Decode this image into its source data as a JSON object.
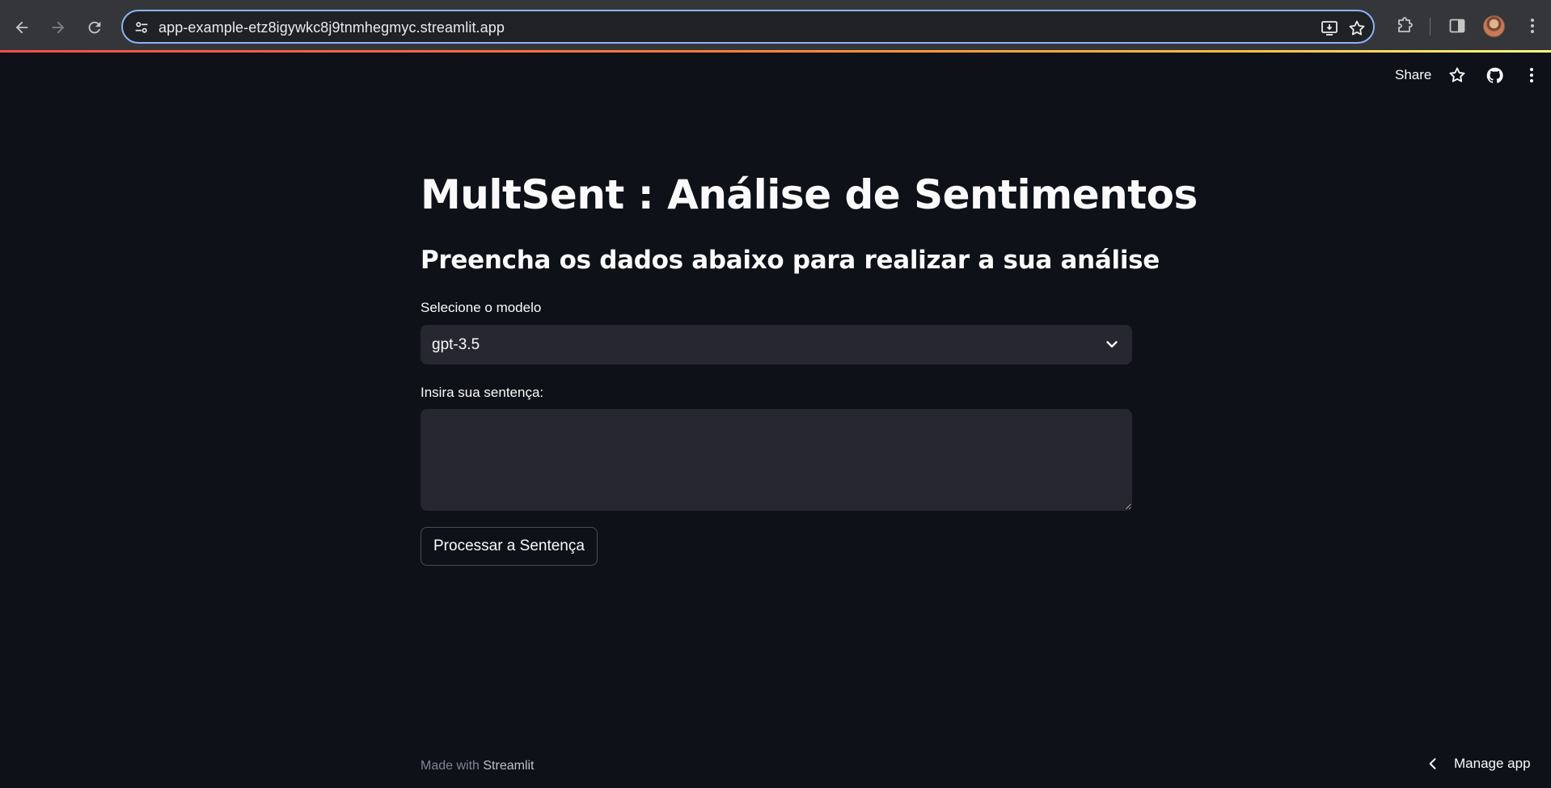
{
  "browser": {
    "url": "app-example-etz8igywkc8j9tnmhegmyc.streamlit.app"
  },
  "header": {
    "share_label": "Share"
  },
  "main": {
    "title": "MultSent : Análise de Sentimentos",
    "subtitle": "Preencha os dados abaixo para realizar a sua análise",
    "model_select": {
      "label": "Selecione o modelo",
      "value": "gpt-3.5"
    },
    "sentence_input": {
      "label": "Insira sua sentença:",
      "value": ""
    },
    "process_button_label": "Processar a Sentença"
  },
  "footer": {
    "made_with": "Made with",
    "brand": "Streamlit",
    "manage_app_label": "Manage app"
  },
  "colors": {
    "background": "#0e1117",
    "widget_background": "#262730",
    "text": "#fafafa",
    "omnibox_focus": "#8ab4f8"
  }
}
